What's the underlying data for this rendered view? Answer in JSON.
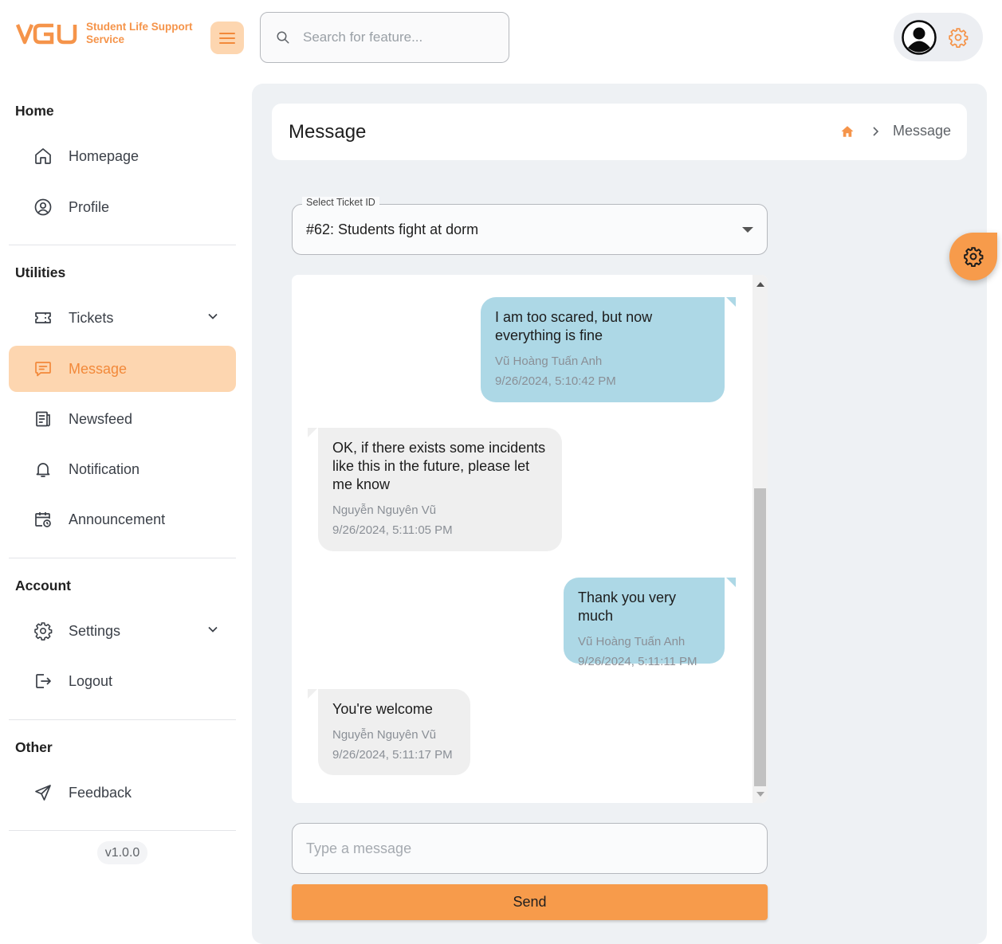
{
  "brand": {
    "logo_text": "VGU",
    "service_name": "Student Life Support Service",
    "accent_color": "#f5944a"
  },
  "search": {
    "placeholder": "Search for feature..."
  },
  "sidebar": {
    "sections": [
      {
        "title": "Home",
        "items": [
          {
            "label": "Homepage",
            "icon": "home-icon"
          },
          {
            "label": "Profile",
            "icon": "profile-icon"
          }
        ]
      },
      {
        "title": "Utilities",
        "items": [
          {
            "label": "Tickets",
            "icon": "ticket-icon",
            "expandable": true
          },
          {
            "label": "Message",
            "icon": "message-icon",
            "active": true
          },
          {
            "label": "Newsfeed",
            "icon": "newsfeed-icon"
          },
          {
            "label": "Notification",
            "icon": "bell-icon"
          },
          {
            "label": "Announcement",
            "icon": "calendar-clock-icon"
          }
        ]
      },
      {
        "title": "Account",
        "items": [
          {
            "label": "Settings",
            "icon": "gear-icon",
            "expandable": true
          },
          {
            "label": "Logout",
            "icon": "logout-icon"
          }
        ]
      },
      {
        "title": "Other",
        "items": [
          {
            "label": "Feedback",
            "icon": "send-icon"
          }
        ]
      }
    ],
    "version": "v1.0.0"
  },
  "page": {
    "title": "Message",
    "breadcrumb": "Message"
  },
  "ticket_select": {
    "legend": "Select Ticket ID",
    "value": "#62: Students fight at dorm"
  },
  "messages": [
    {
      "text": "I am too scared, but now everything is fine",
      "sender": "Vũ Hoàng Tuấn Anh",
      "time": "9/26/2024, 5:10:42 PM",
      "mine": true
    },
    {
      "text": "OK, if there exists some incidents like this in the future, please let me know",
      "sender": "Nguyễn Nguyên Vũ",
      "time": "9/26/2024, 5:11:05 PM",
      "mine": false
    },
    {
      "text": "Thank you very much",
      "sender": "Vũ Hoàng Tuấn Anh",
      "time": "9/26/2024, 5:11:11 PM",
      "mine": true
    },
    {
      "text": "You're welcome",
      "sender": "Nguyễn Nguyên Vũ",
      "time": "9/26/2024, 5:11:17 PM",
      "mine": false
    }
  ],
  "composer": {
    "placeholder": "Type a message",
    "send_label": "Send"
  },
  "colors": {
    "my_bubble": "#add8e6",
    "their_bubble": "#efefef",
    "active_nav_bg": "#fdd6b0",
    "send_button": "#f79b4b"
  }
}
